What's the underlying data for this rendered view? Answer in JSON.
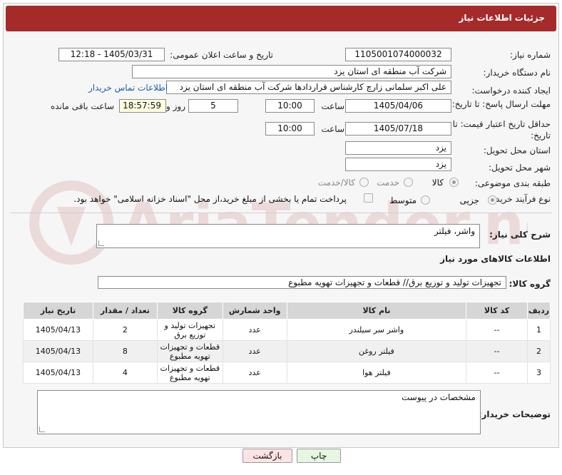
{
  "header": {
    "title": "جزئیات اطلاعات نیاز"
  },
  "fields": {
    "need_number_label": "شماره نیاز:",
    "need_number": "1105001074000032",
    "announce_label": "تاریخ و ساعت اعلان عمومی:",
    "announce_value": "1405/03/31 - 12:18",
    "buyer_org_label": "نام دستگاه خریدار:",
    "buyer_org": "شرکت آب منطقه ای استان یزد",
    "creator_label": "ایجاد کننده درخواست:",
    "creator": "علی اکبر سلمانی زارچ کارشناس قراردادها شرکت آب منطقه ای استان یزد",
    "contact_link": "اطلاعات تماس خریدار",
    "reply_deadline_label": "مهلت ارسال پاسخ: تا تاریخ:",
    "reply_date": "1405/04/06",
    "time_label": "ساعت",
    "reply_time": "10:00",
    "days_value": "5",
    "days_label": "روز و",
    "remaining_time": "18:57:59",
    "remaining_label": "ساعت باقی مانده",
    "price_deadline_label": "حداقل تاریخ اعتبار قیمت: تا تاریخ:",
    "price_date": "1405/07/18",
    "price_time": "10:00",
    "province_label": "استان محل تحویل:",
    "province": "یزد",
    "city_label": "شهر محل تحویل:",
    "city": "یزد",
    "category_label": "طبقه بندی موضوعی:",
    "category_options": [
      "کالا",
      "خدمت",
      "کالا/خدمت"
    ],
    "process_label": "نوع فرآیند خرید :",
    "process_options": [
      "جزیی",
      "متوسط"
    ],
    "payment_note": "پرداخت تمام یا بخشی از مبلغ خرید،از محل \"اسناد خزانه اسلامی\" خواهد بود.",
    "summary_label": "شرح کلی نیاز:",
    "summary": "واشر، فیلتر",
    "goods_info_title": "اطلاعات کالاهای مورد نیاز",
    "goods_group_label": "گروه کالا:",
    "goods_group": "تجهیزات تولید و توزیع برق// قطعات و تجهیزات تهویه مطبوع",
    "buyer_notes_label": "توضیحات خریدار:",
    "buyer_notes": "مشخصات در پیوست"
  },
  "table": {
    "headers": [
      "ردیف",
      "کد کالا",
      "نام کالا",
      "واحد شمارش",
      "گروه کالا",
      "تعداد / مقدار",
      "تاریخ نیاز"
    ],
    "rows": [
      [
        "1",
        "--",
        "واشر سر سیلندر",
        "عدد",
        "تجهیزات تولید و توزیع برق",
        "2",
        "1405/04/13"
      ],
      [
        "2",
        "--",
        "فیلتر روغن",
        "عدد",
        "قطعات و تجهیزات تهویه مطبوع",
        "8",
        "1405/04/13"
      ],
      [
        "3",
        "--",
        "فیلتر هوا",
        "عدد",
        "قطعات و تجهیزات تهویه مطبوع",
        "4",
        "1405/04/13"
      ]
    ]
  },
  "buttons": {
    "print": "چاپ",
    "back": "بازگشت"
  },
  "watermark": "AriaTender.neT",
  "colors": {
    "header": "#a52a2a",
    "link": "#1a5fb4",
    "print_btn": "#e6f6e0",
    "back_btn": "#fde4e4"
  }
}
